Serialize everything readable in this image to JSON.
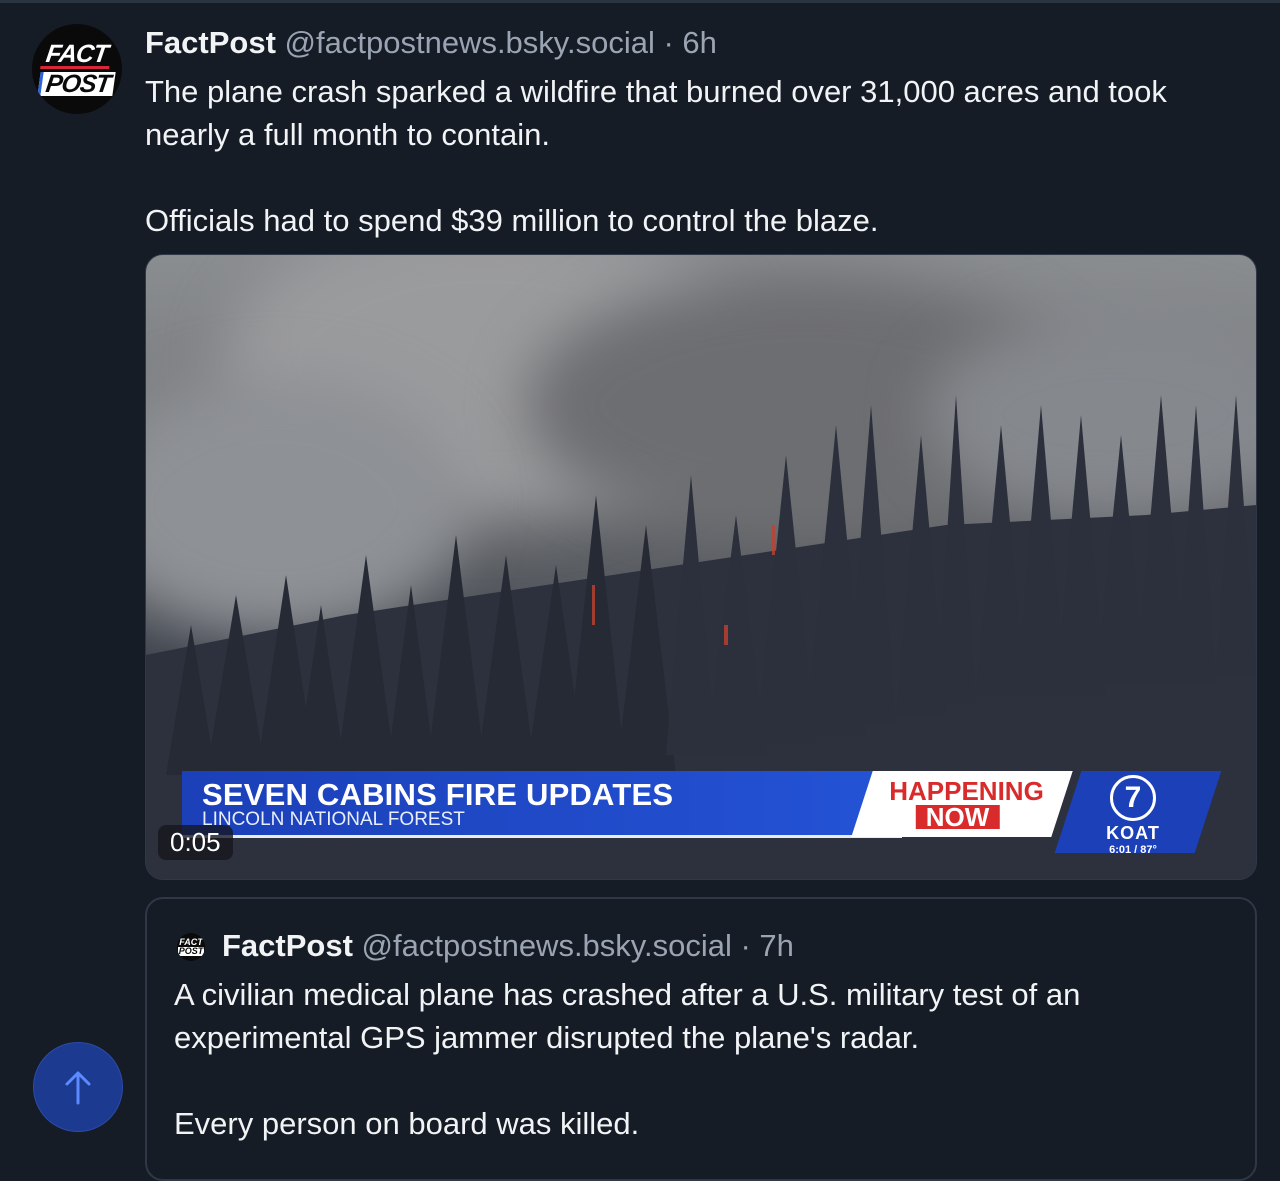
{
  "post": {
    "avatar": {
      "line1": "FACT",
      "line2": "POST"
    },
    "author_name": "FactPost",
    "author_handle": "@factpostnews.bsky.social",
    "age": "· 6h",
    "text_p1": "The plane crash sparked a wildfire that burned over 31,000 acres and took nearly a full month to contain.",
    "text_p2": "Officials had to spend $39 million to control the blaze."
  },
  "video": {
    "headline": "SEVEN CABINS FIRE UPDATES",
    "subheadline": "LINCOLN NATIONAL FOREST",
    "badge_line1": "HAPPENING",
    "badge_line2": "NOW",
    "station_number": "7",
    "station_name": "KOAT",
    "time_temp": "6:01 / 87°",
    "timestamp": "0:05"
  },
  "quoted_post": {
    "avatar": {
      "line1": "FACT",
      "line2": "POST"
    },
    "author_name": "FactPost",
    "author_handle": "@factpostnews.bsky.social",
    "age": "· 7h",
    "text_p1": "A civilian medical plane has crashed after a U.S. military test of an experimental GPS jammer disrupted the plane's radar.",
    "text_p2": "Every person on board was killed."
  },
  "scroll_top_button": {
    "icon": "arrow-up-icon"
  },
  "colors": {
    "background": "#151c26",
    "accent": "#2c62d9",
    "muted_text": "#9aa4b2"
  }
}
